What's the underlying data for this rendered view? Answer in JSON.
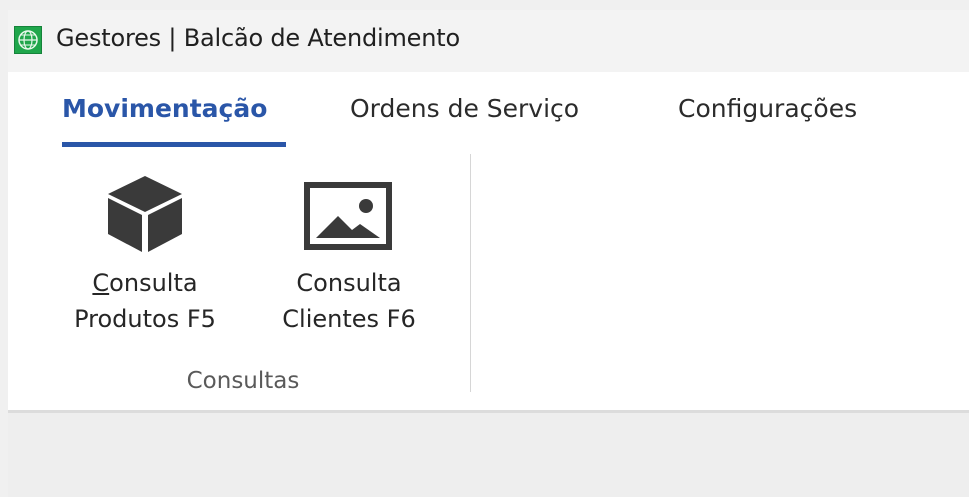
{
  "window": {
    "title": "Gestores | Balcão de Atendimento",
    "icon": "globe-icon",
    "accent_color": "#1fa64b"
  },
  "ribbon": {
    "tabs": [
      {
        "label": "Movimentação",
        "active": true
      },
      {
        "label": "Ordens de Serviço",
        "active": false
      },
      {
        "label": "Configurações",
        "active": false
      }
    ],
    "active_color": "#2a56a8",
    "groups": [
      {
        "label": "Consultas",
        "buttons": [
          {
            "line1_accel": "C",
            "line1_rest": "onsulta",
            "line2": "Produtos F5",
            "icon": "cube-icon"
          },
          {
            "line1": "Consulta",
            "line2": "Clientes F6",
            "icon": "image-icon"
          }
        ]
      }
    ]
  }
}
